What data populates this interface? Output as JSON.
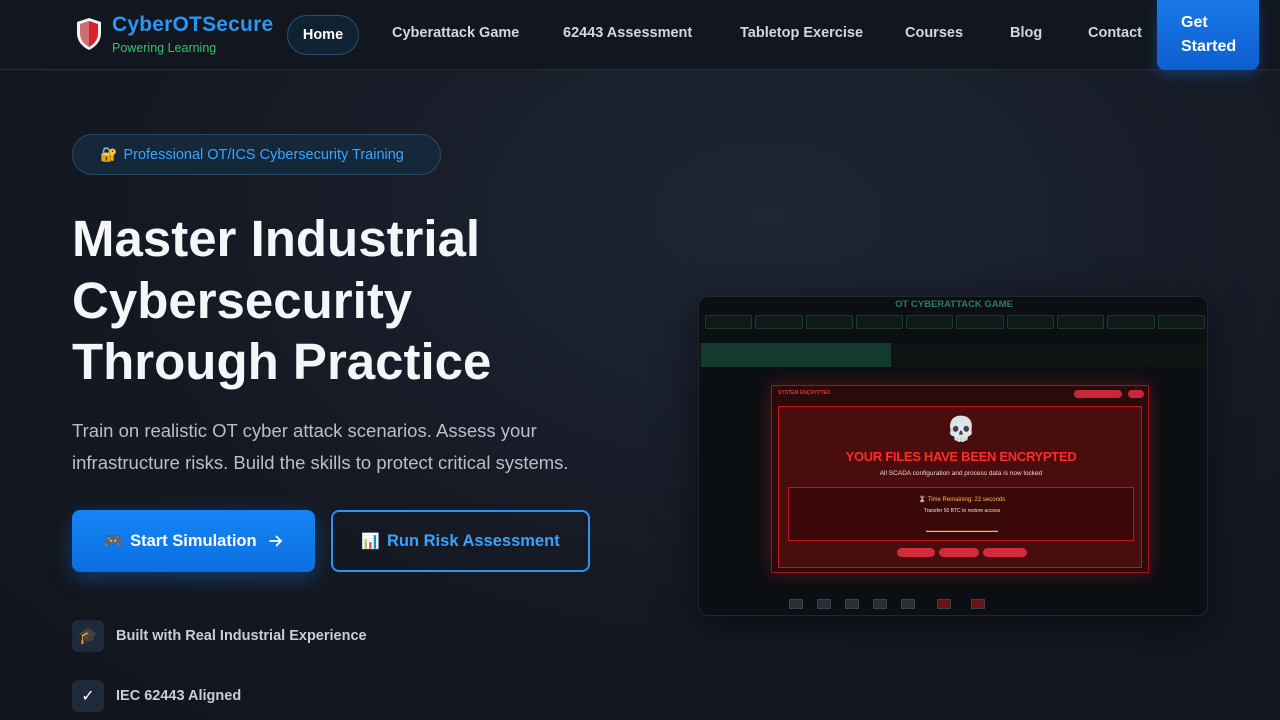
{
  "header": {
    "brand": "CyberOTSecure",
    "tagline": "Powering Learning",
    "nav": [
      {
        "label": "Home"
      },
      {
        "label": "Cyberattack Game"
      },
      {
        "label": "62443 Assessment"
      },
      {
        "label": "Tabletop Exercise"
      },
      {
        "label": "Courses"
      },
      {
        "label": "Blog"
      },
      {
        "label": "Contact"
      }
    ],
    "cta_line1": "Get",
    "cta_line2": "Started"
  },
  "hero": {
    "badge": "Professional OT/ICS Cybersecurity Training",
    "badge_icon": "🔐",
    "title_line1": "Master Industrial",
    "title_line2": "Cybersecurity",
    "title_line3": "Through Practice",
    "description": "Train on realistic OT cyber attack scenarios. Assess your infrastructure risks. Build the skills to protect critical systems.",
    "primary_button": "Start Simulation",
    "primary_icon": "🎮",
    "secondary_button": "Run Risk Assessment",
    "secondary_icon": "📊"
  },
  "features": [
    {
      "icon": "🎓",
      "label": "Built with Real Industrial Experience"
    },
    {
      "icon": "✓",
      "label": "IEC 62443 Aligned"
    }
  ],
  "preview": {
    "title": "OT CYBERATTACK GAME",
    "modal_label": "SYSTEM ENCRYPTED",
    "skull": "💀",
    "headline": "YOUR FILES HAVE BEEN ENCRYPTED",
    "subtext": "All SCADA configuration and process data is now locked",
    "timer": "⌛ Time Remaining: 22 seconds",
    "transfer": "Transfer 50 BTC to restore access"
  },
  "colors": {
    "accent": "#2b95f3",
    "tagline": "#31c46b",
    "danger": "#ff2b2b"
  }
}
